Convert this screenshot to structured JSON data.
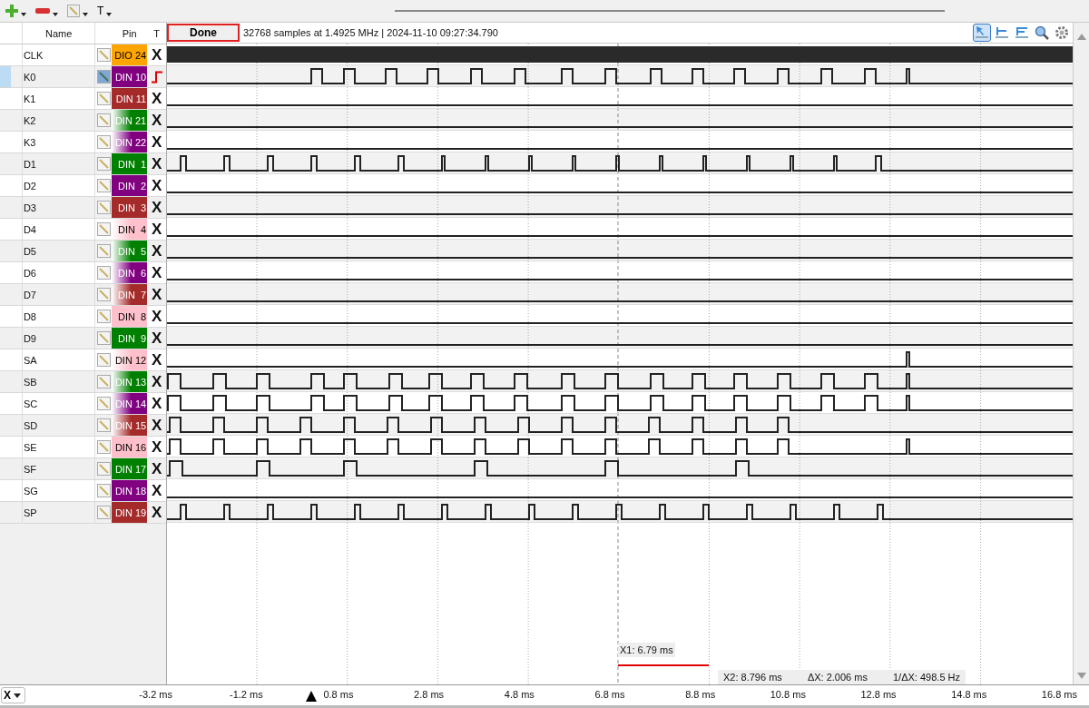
{
  "toolbar": {
    "tools": [
      {
        "kind": "add"
      },
      {
        "kind": "remove"
      },
      {
        "kind": "edit"
      },
      {
        "kind": "text",
        "label": "T"
      }
    ]
  },
  "header": {
    "name": "Name",
    "pin": "Pin",
    "trigger": "T"
  },
  "status": {
    "button": "Done",
    "info": "32768 samples at 1.4925 MHz | 2024-11-10 09:27:34.790"
  },
  "plot_tools": [
    {
      "kind": "pointer",
      "selected": true
    },
    {
      "kind": "cursor-one",
      "selected": false
    },
    {
      "kind": "cursor-two",
      "selected": false
    },
    {
      "kind": "zoom",
      "selected": false
    },
    {
      "kind": "settings",
      "selected": false
    }
  ],
  "channels": [
    {
      "name": "CLK",
      "pin": "DIO 24",
      "color": "#ffa500",
      "gradient": false,
      "trigger": {
        "kind": "none",
        "label": "X"
      },
      "selected": false
    },
    {
      "name": "K0",
      "pin": "DIN 10",
      "color": "#800080",
      "gradient": false,
      "trigger": {
        "kind": "rising"
      },
      "selected": true
    },
    {
      "name": "K1",
      "pin": "DIN 11",
      "color": "#a52a2a",
      "gradient": false,
      "trigger": {
        "kind": "none",
        "label": "X"
      },
      "selected": false
    },
    {
      "name": "K2",
      "pin": "DIN 21",
      "color": "#008000",
      "gradient": true,
      "trigger": {
        "kind": "none",
        "label": "X"
      },
      "selected": false
    },
    {
      "name": "K3",
      "pin": "DIN 22",
      "color": "#800080",
      "gradient": true,
      "trigger": {
        "kind": "none",
        "label": "X"
      },
      "selected": false
    },
    {
      "name": "D1",
      "pin": "DIN  1",
      "color": "#008000",
      "gradient": false,
      "trigger": {
        "kind": "none",
        "label": "X"
      },
      "selected": false
    },
    {
      "name": "D2",
      "pin": "DIN  2",
      "color": "#800080",
      "gradient": false,
      "trigger": {
        "kind": "none",
        "label": "X"
      },
      "selected": false
    },
    {
      "name": "D3",
      "pin": "DIN  3",
      "color": "#a52a2a",
      "gradient": false,
      "trigger": {
        "kind": "none",
        "label": "X"
      },
      "selected": false
    },
    {
      "name": "D4",
      "pin": "DIN  4",
      "color": "#ffc0cb",
      "gradient": true,
      "trigger": {
        "kind": "none",
        "label": "X"
      },
      "selected": false
    },
    {
      "name": "D5",
      "pin": "DIN  5",
      "color": "#008000",
      "gradient": true,
      "trigger": {
        "kind": "none",
        "label": "X"
      },
      "selected": false
    },
    {
      "name": "D6",
      "pin": "DIN  6",
      "color": "#800080",
      "gradient": true,
      "trigger": {
        "kind": "none",
        "label": "X"
      },
      "selected": false
    },
    {
      "name": "D7",
      "pin": "DIN  7",
      "color": "#a52a2a",
      "gradient": true,
      "trigger": {
        "kind": "none",
        "label": "X"
      },
      "selected": false
    },
    {
      "name": "D8",
      "pin": "DIN  8",
      "color": "#ffc0cb",
      "gradient": false,
      "trigger": {
        "kind": "none",
        "label": "X"
      },
      "selected": false
    },
    {
      "name": "D9",
      "pin": "DIN  9",
      "color": "#008000",
      "gradient": false,
      "trigger": {
        "kind": "none",
        "label": "X"
      },
      "selected": false
    },
    {
      "name": "SA",
      "pin": "DIN 12",
      "color": "#ffc0cb",
      "gradient": true,
      "trigger": {
        "kind": "none",
        "label": "X"
      },
      "selected": false
    },
    {
      "name": "SB",
      "pin": "DIN 13",
      "color": "#008000",
      "gradient": true,
      "trigger": {
        "kind": "none",
        "label": "X"
      },
      "selected": false
    },
    {
      "name": "SC",
      "pin": "DIN 14",
      "color": "#800080",
      "gradient": true,
      "trigger": {
        "kind": "none",
        "label": "X"
      },
      "selected": false
    },
    {
      "name": "SD",
      "pin": "DIN 15",
      "color": "#a52a2a",
      "gradient": true,
      "trigger": {
        "kind": "none",
        "label": "X"
      },
      "selected": false
    },
    {
      "name": "SE",
      "pin": "DIN 16",
      "color": "#ffc0cb",
      "gradient": false,
      "trigger": {
        "kind": "none",
        "label": "X"
      },
      "selected": false
    },
    {
      "name": "SF",
      "pin": "DIN 17",
      "color": "#008000",
      "gradient": false,
      "trigger": {
        "kind": "none",
        "label": "X"
      },
      "selected": false
    },
    {
      "name": "SG",
      "pin": "DIN 18",
      "color": "#800080",
      "gradient": false,
      "trigger": {
        "kind": "none",
        "label": "X"
      },
      "selected": false
    },
    {
      "name": "SP",
      "pin": "DIN 19",
      "color": "#a52a2a",
      "gradient": false,
      "trigger": {
        "kind": "none",
        "label": "X"
      },
      "selected": false
    }
  ],
  "cursors": {
    "x1": "X1: 6.79 ms",
    "x2": "X2: 8.796 ms",
    "dx": "ΔX: 2.006 ms",
    "inv_dx": "1/ΔX: 498.5 Hz"
  },
  "axis": {
    "selector": "X",
    "labels": [
      "-3.2 ms",
      "-1.2 ms",
      "0.8 ms",
      "2.8 ms",
      "4.8 ms",
      "6.8 ms",
      "8.8 ms",
      "10.8 ms",
      "12.8 ms",
      "14.8 ms",
      "16.8 ms"
    ]
  }
}
